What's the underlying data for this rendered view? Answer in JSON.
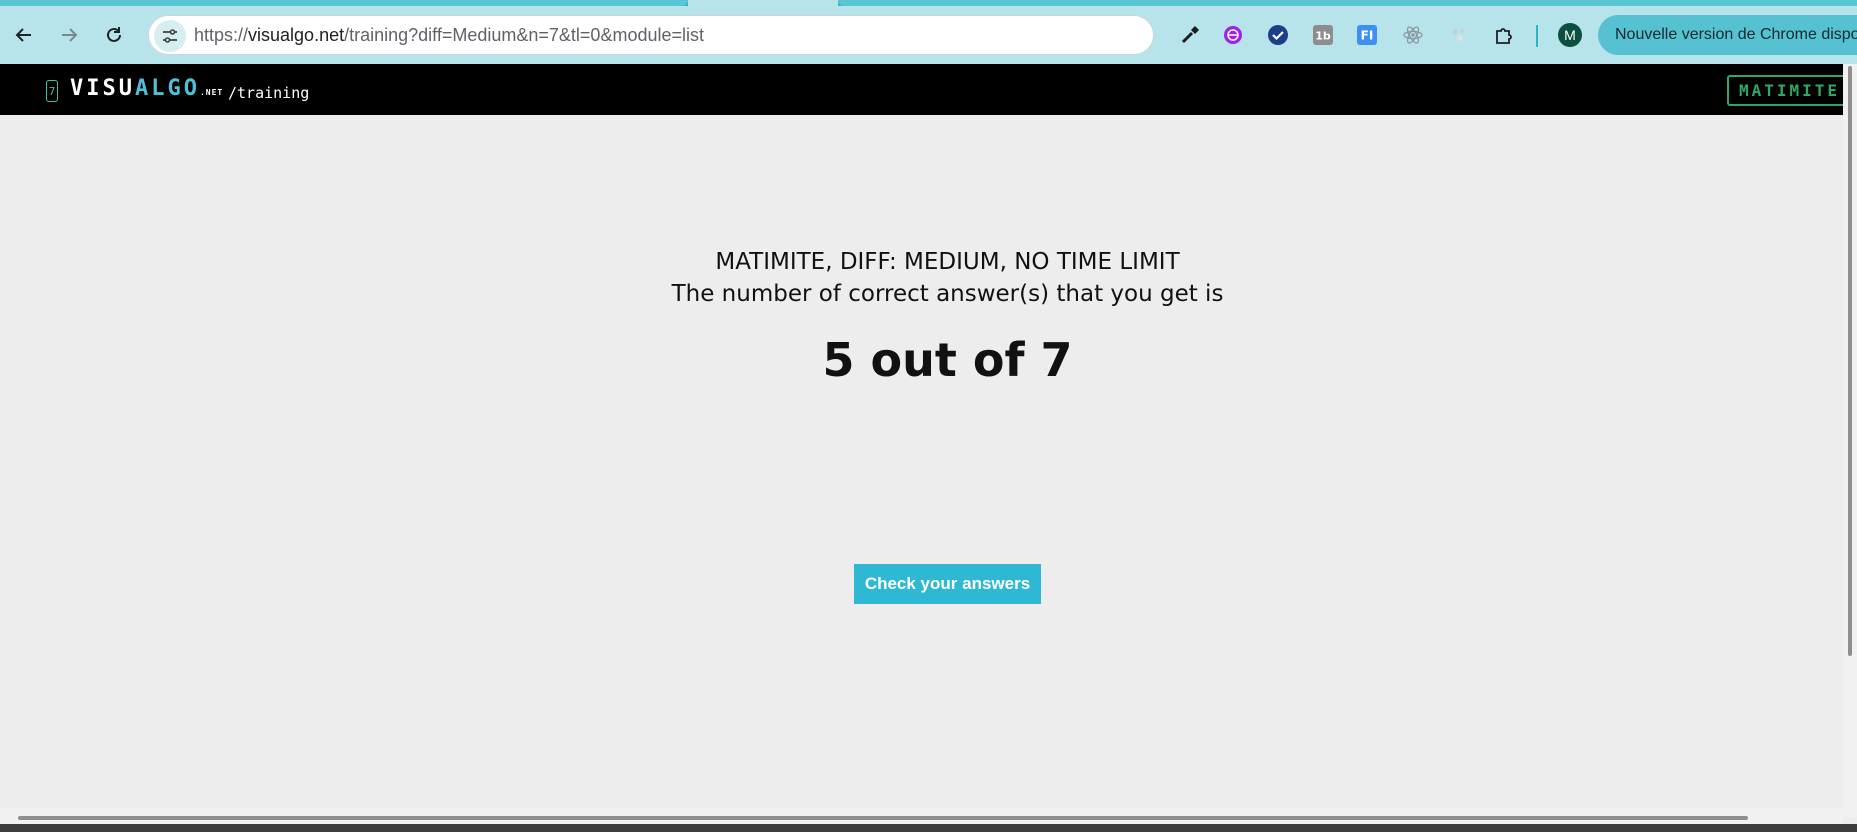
{
  "browser": {
    "url_prefix": "https://",
    "url_host": "visualgo.net",
    "url_path": "/training?diff=Medium&n=7&tl=0&module=list",
    "profile_initial": "M",
    "update_chip": "Nouvelle version de Chrome disponible",
    "extensions": [
      "eyedropper-icon",
      "vpn-icon",
      "checkmark-icon",
      "1b-icon",
      "fi-icon",
      "react-icon",
      "puzzle-dots-icon",
      "extensions-puzzle-icon"
    ],
    "colors": {
      "toolbar": "#b7e4ea",
      "accent": "#2fb3c6"
    }
  },
  "site": {
    "logo_badge": "7",
    "logo_visu": "VISU",
    "logo_algo": "ALGO",
    "logo_net": ".NET",
    "logo_path": "/training",
    "user_button": "MATIMITE"
  },
  "results": {
    "mode_line": "MATIMITE, DIFF: MEDIUM, NO TIME LIMIT",
    "answer_line": "The number of correct answer(s) that you get is",
    "score": "5 out of 7",
    "correct": 5,
    "total": 7,
    "check_button": "Check your answers",
    "colors": {
      "button": "#2fb8d3"
    }
  }
}
